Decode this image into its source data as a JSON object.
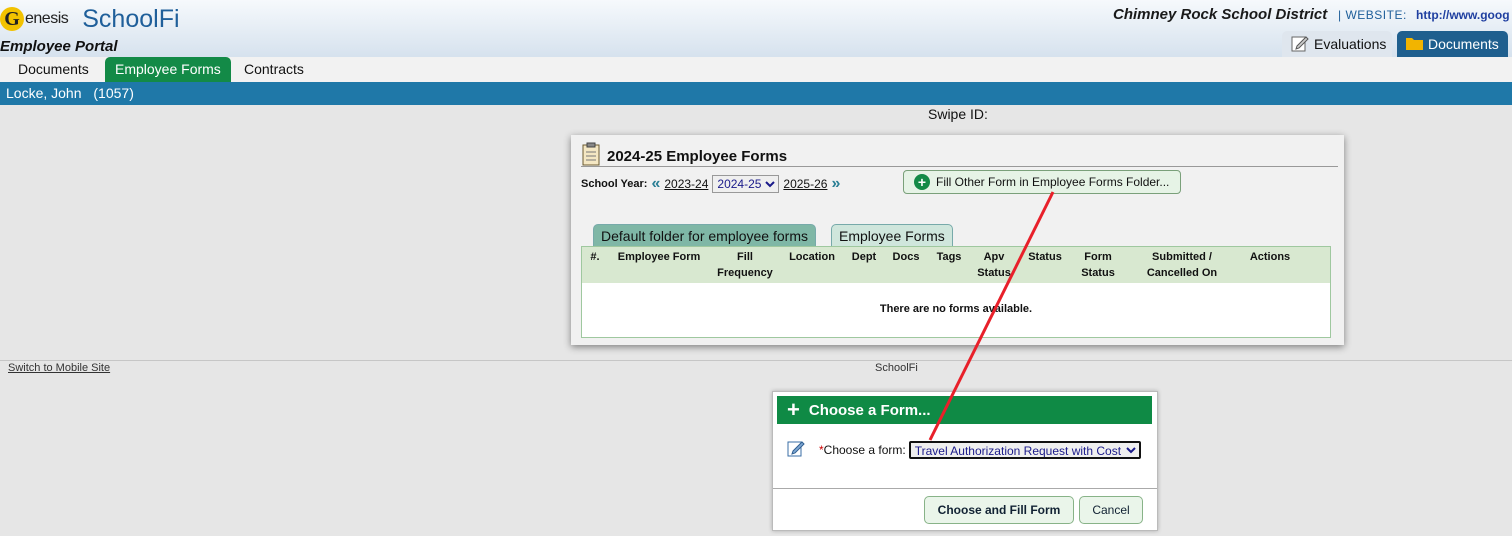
{
  "header": {
    "logo_letter": "G",
    "logo_genesis": "enesis",
    "logo_schoolfi": "SchoolFi",
    "portal": "Employee Portal",
    "district": "Chimney Rock School District",
    "website_label": "|  WEBSITE:",
    "website_url": "http://www.goog",
    "tabs": [
      {
        "label": "Evaluations",
        "icon": "edit-icon"
      },
      {
        "label": "Documents",
        "icon": "folder-icon"
      }
    ]
  },
  "nav": {
    "tabs": [
      "Documents",
      "Employee Forms",
      "Contracts"
    ],
    "active": "Employee Forms"
  },
  "employee": {
    "name": "Locke, John",
    "id": "(1057)"
  },
  "swipe_label": "Swipe ID:",
  "panel": {
    "title": "2024-25 Employee Forms",
    "school_year_label": "School Year:",
    "prev_year": "2023-24",
    "current_year": "2024-25",
    "next_year": "2025-26",
    "fill_button": "Fill Other Form in Employee Forms Folder...",
    "folder_tabs": [
      "Default folder for employee forms",
      "Employee Forms"
    ],
    "columns": [
      {
        "line1": "",
        "line2": "#."
      },
      {
        "line1": "",
        "line2": "Employee Form"
      },
      {
        "line1": "Fill",
        "line2": "Frequency"
      },
      {
        "line1": "",
        "line2": "Location"
      },
      {
        "line1": "",
        "line2": "Dept"
      },
      {
        "line1": "",
        "line2": "Docs"
      },
      {
        "line1": "",
        "line2": "Tags"
      },
      {
        "line1": "Apv",
        "line2": "Status"
      },
      {
        "line1": "",
        "line2": "Status"
      },
      {
        "line1": "Form",
        "line2": "Status"
      },
      {
        "line1": "Submitted /",
        "line2": "Cancelled On"
      },
      {
        "line1": "",
        "line2": "Actions"
      }
    ],
    "empty_message": "There are no forms available."
  },
  "footer": {
    "mobile_link": "Switch to Mobile Site",
    "brand": "SchoolFi"
  },
  "dialog": {
    "title": "Choose a Form...",
    "required_mark": "*",
    "field_label": "Choose a form:",
    "selected_form": "Travel Authorization Request with Cost",
    "choose_button": "Choose and Fill Form",
    "cancel_button": "Cancel"
  },
  "colors": {
    "green": "#138a47",
    "blue": "#1f78a8",
    "annotation": "#e8202a"
  }
}
